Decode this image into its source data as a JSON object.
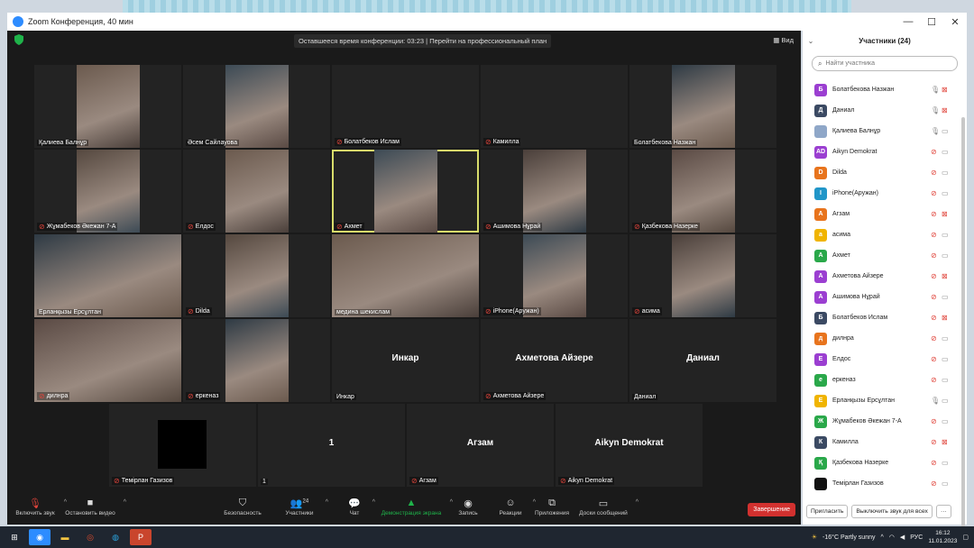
{
  "window": {
    "title": "Zoom Конференция, 40 мин",
    "minimize": "—",
    "maximize": "☐",
    "close": "✕"
  },
  "topbar": {
    "timer": "Оставшееся время конференции: 03:23 | Перейти на профессиональный план",
    "view": "Вид"
  },
  "tiles": [
    {
      "name": "Қалиева Балнұр",
      "muted": false,
      "video": true
    },
    {
      "name": "Әсем Сайлауова",
      "muted": false,
      "video": true
    },
    {
      "name": "Болатбеков Ислам",
      "muted": true,
      "video": false
    },
    {
      "name": "Камилла",
      "muted": true,
      "video": false
    },
    {
      "name": "Болатбекова Назжан",
      "muted": false,
      "video": true
    },
    {
      "name": "Жұмабеков Әкежан 7-А",
      "muted": true,
      "video": true
    },
    {
      "name": "Елдос",
      "muted": true,
      "video": true
    },
    {
      "name": "Ахмет",
      "muted": true,
      "video": true
    },
    {
      "name": "Ашимова Нұрай",
      "muted": true,
      "video": true
    },
    {
      "name": "Қазбекова Назерке",
      "muted": true,
      "video": true
    },
    {
      "name": "Ерланқызы Ерсұлтан",
      "muted": false,
      "video": true
    },
    {
      "name": "Dilda",
      "muted": true,
      "video": true
    },
    {
      "name": "медина шекислам",
      "muted": false,
      "video": true
    },
    {
      "name": "iPhone(Аружан)",
      "muted": true,
      "video": true
    },
    {
      "name": "асима",
      "muted": true,
      "video": true
    },
    {
      "name": "дилнра",
      "muted": true,
      "video": true
    },
    {
      "name": "еркеназ",
      "muted": true,
      "video": true
    },
    {
      "name": "Инкар",
      "muted": false,
      "video": false,
      "center": "Инкар"
    },
    {
      "name": "Ахметова Айзере",
      "muted": true,
      "video": false,
      "center": "Ахметова Айзере"
    },
    {
      "name": "Даниал",
      "muted": false,
      "video": false,
      "center": "Даниал"
    },
    {
      "name": "Темірлан Газизов",
      "muted": true,
      "video": true
    },
    {
      "name": "1",
      "muted": false,
      "video": false,
      "center": "1"
    },
    {
      "name": "Агзам",
      "muted": true,
      "video": false,
      "center": "Агзам"
    },
    {
      "name": "Aikyn Demokrat",
      "muted": true,
      "video": false,
      "center": "Aikyn Demokrat"
    }
  ],
  "toolbar": {
    "mute": "Включить звук",
    "video": "Остановить видео",
    "security": "Безопасность",
    "participants": "Участники",
    "participants_count": "24",
    "chat": "Чат",
    "share": "Демонстрация экрана",
    "record": "Запись",
    "reactions": "Реакции",
    "apps": "Приложения",
    "whiteboard": "Доски сообщений",
    "end": "Завершение"
  },
  "panel": {
    "title": "Участники (24)",
    "search_placeholder": "Найти участника",
    "invite": "Пригласить",
    "mute_all": "Выключить звук для всех",
    "more": "···",
    "participants": [
      {
        "initial": "Б",
        "color": "#9b3fd1",
        "name": "Болатбекова Назжан",
        "muted": false,
        "video": false
      },
      {
        "initial": "Д",
        "color": "#3b4a63",
        "name": "Даниал",
        "muted": false,
        "video": false
      },
      {
        "initial": "",
        "color": "#8fa7c8",
        "name": "Қалиева Балнұр",
        "muted": false,
        "video": true
      },
      {
        "initial": "AD",
        "color": "#9b3fd1",
        "name": "Aikyn Demokrat",
        "muted": true,
        "video": true
      },
      {
        "initial": "D",
        "color": "#e8741d",
        "name": "Dilda",
        "muted": true,
        "video": true
      },
      {
        "initial": "I",
        "color": "#2196c8",
        "name": "iPhone(Аружан)",
        "muted": true,
        "video": true
      },
      {
        "initial": "А",
        "color": "#e8741d",
        "name": "Агзам",
        "muted": true,
        "video": false
      },
      {
        "initial": "а",
        "color": "#f0b400",
        "name": "асима",
        "muted": true,
        "video": true
      },
      {
        "initial": "А",
        "color": "#2aa84a",
        "name": "Ахмет",
        "muted": true,
        "video": true
      },
      {
        "initial": "А",
        "color": "#9b3fd1",
        "name": "Ахметова Айзере",
        "muted": true,
        "video": false
      },
      {
        "initial": "А",
        "color": "#9b3fd1",
        "name": "Ашимова Нұрай",
        "muted": true,
        "video": true
      },
      {
        "initial": "Б",
        "color": "#3b4a63",
        "name": "Болатбеков Ислам",
        "muted": true,
        "video": false
      },
      {
        "initial": "д",
        "color": "#e8741d",
        "name": "дилнра",
        "muted": true,
        "video": true
      },
      {
        "initial": "Е",
        "color": "#9b3fd1",
        "name": "Елдос",
        "muted": true,
        "video": true
      },
      {
        "initial": "е",
        "color": "#2aa84a",
        "name": "еркеназ",
        "muted": true,
        "video": true
      },
      {
        "initial": "Е",
        "color": "#f0b400",
        "name": "Ерланқызы Ерсұлтан",
        "muted": false,
        "video": true
      },
      {
        "initial": "Ж",
        "color": "#2aa84a",
        "name": "Жұмабеков Әкежан 7-А",
        "muted": true,
        "video": true
      },
      {
        "initial": "К",
        "color": "#3b4a63",
        "name": "Камилла",
        "muted": true,
        "video": false
      },
      {
        "initial": "Қ",
        "color": "#2aa84a",
        "name": "Қазбекова Назерке",
        "muted": true,
        "video": true
      },
      {
        "initial": "",
        "color": "#111111",
        "name": "Темірлан Газизов",
        "muted": true,
        "video": true
      }
    ]
  },
  "taskbar": {
    "weather": "-16°C  Partly sunny",
    "lang": "РУС",
    "time": "16:12",
    "date": "11.01.2023"
  }
}
